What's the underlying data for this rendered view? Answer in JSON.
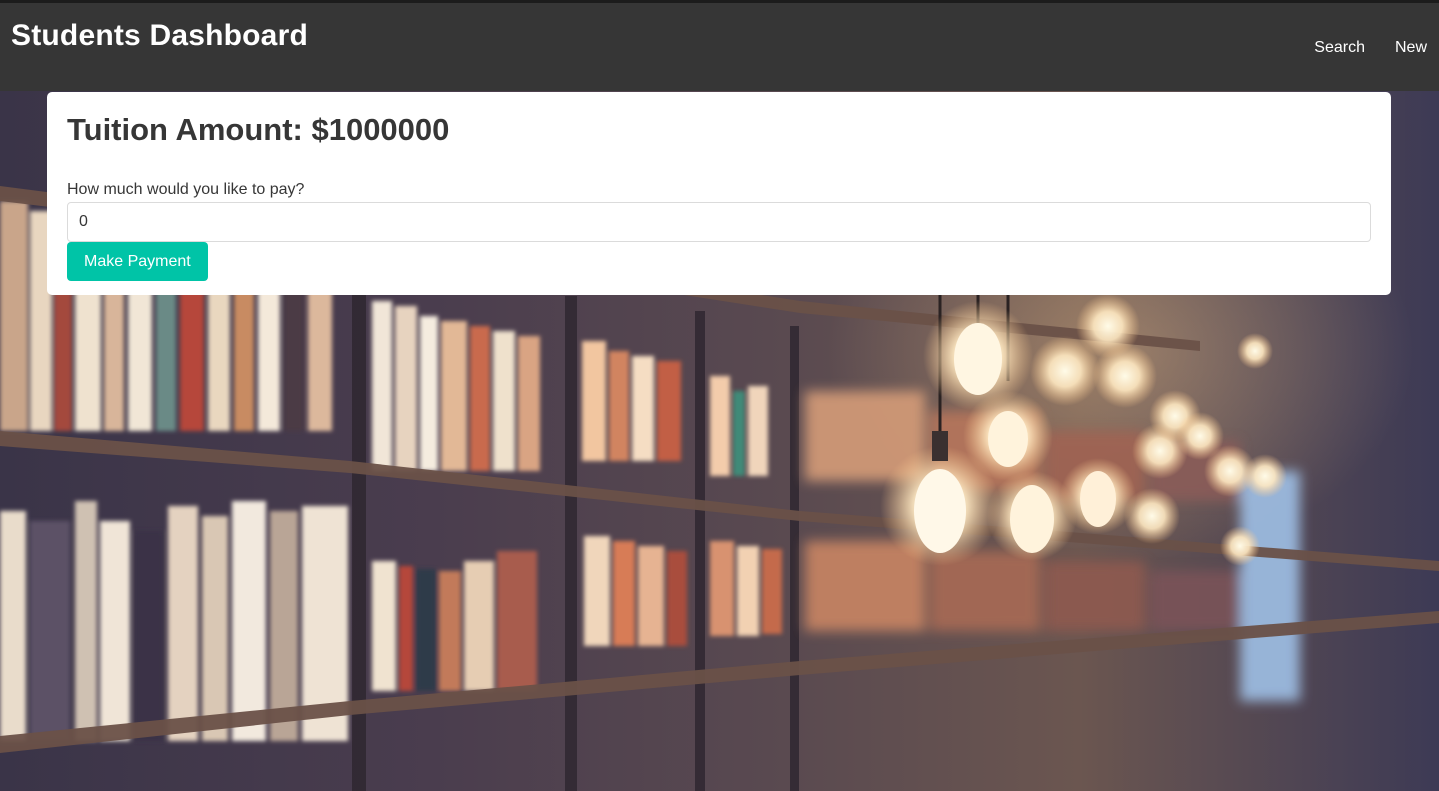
{
  "navbar": {
    "brand": "Students Dashboard",
    "links": [
      {
        "label": "Search"
      },
      {
        "label": "New"
      }
    ]
  },
  "payment": {
    "title": "Tuition Amount: $1000000",
    "label": "How much would you like to pay?",
    "input_value": "0",
    "button_label": "Make Payment"
  },
  "colors": {
    "navbar_bg": "#363636",
    "button_accent": "#00c4a7",
    "card_bg": "#ffffff"
  }
}
